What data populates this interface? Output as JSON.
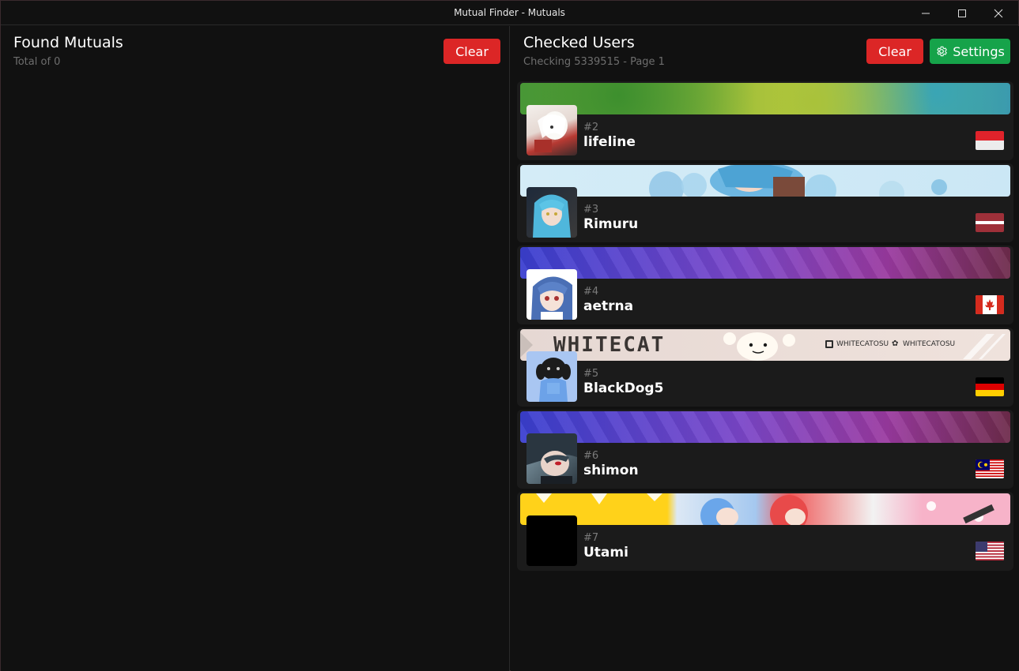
{
  "window": {
    "title": "Mutual Finder - Mutuals"
  },
  "left_panel": {
    "title": "Found Mutuals",
    "subtitle": "Total of 0",
    "clear_label": "Clear"
  },
  "right_panel": {
    "title": "Checked Users",
    "subtitle": "Checking 5339515 - Page 1",
    "clear_label": "Clear",
    "settings_label": "Settings",
    "users": [
      {
        "rank": "#2",
        "name": "lifeline",
        "flag": "indonesia",
        "banner": "green-watercolor"
      },
      {
        "rank": "#3",
        "name": "Rimuru",
        "flag": "latvia",
        "banner": "light-blue-anime"
      },
      {
        "rank": "#4",
        "name": "aetrna",
        "flag": "canada",
        "banner": "purple-gradient"
      },
      {
        "rank": "#5",
        "name": "BlackDog5",
        "flag": "germany",
        "banner": "whitecat-banner",
        "banner_text": "WHITECAT",
        "banner_handle": "WHITECATOSU"
      },
      {
        "rank": "#6",
        "name": "shimon",
        "flag": "malaysia",
        "banner": "purple-gradient"
      },
      {
        "rank": "#7",
        "name": "Utami",
        "flag": "usa",
        "banner": "yellow-pink-anime"
      }
    ]
  },
  "colors": {
    "background": "#111111",
    "card": "#1b1b1b",
    "danger": "#dc2626",
    "success": "#16a34a",
    "muted_text": "#6e6e6e"
  }
}
